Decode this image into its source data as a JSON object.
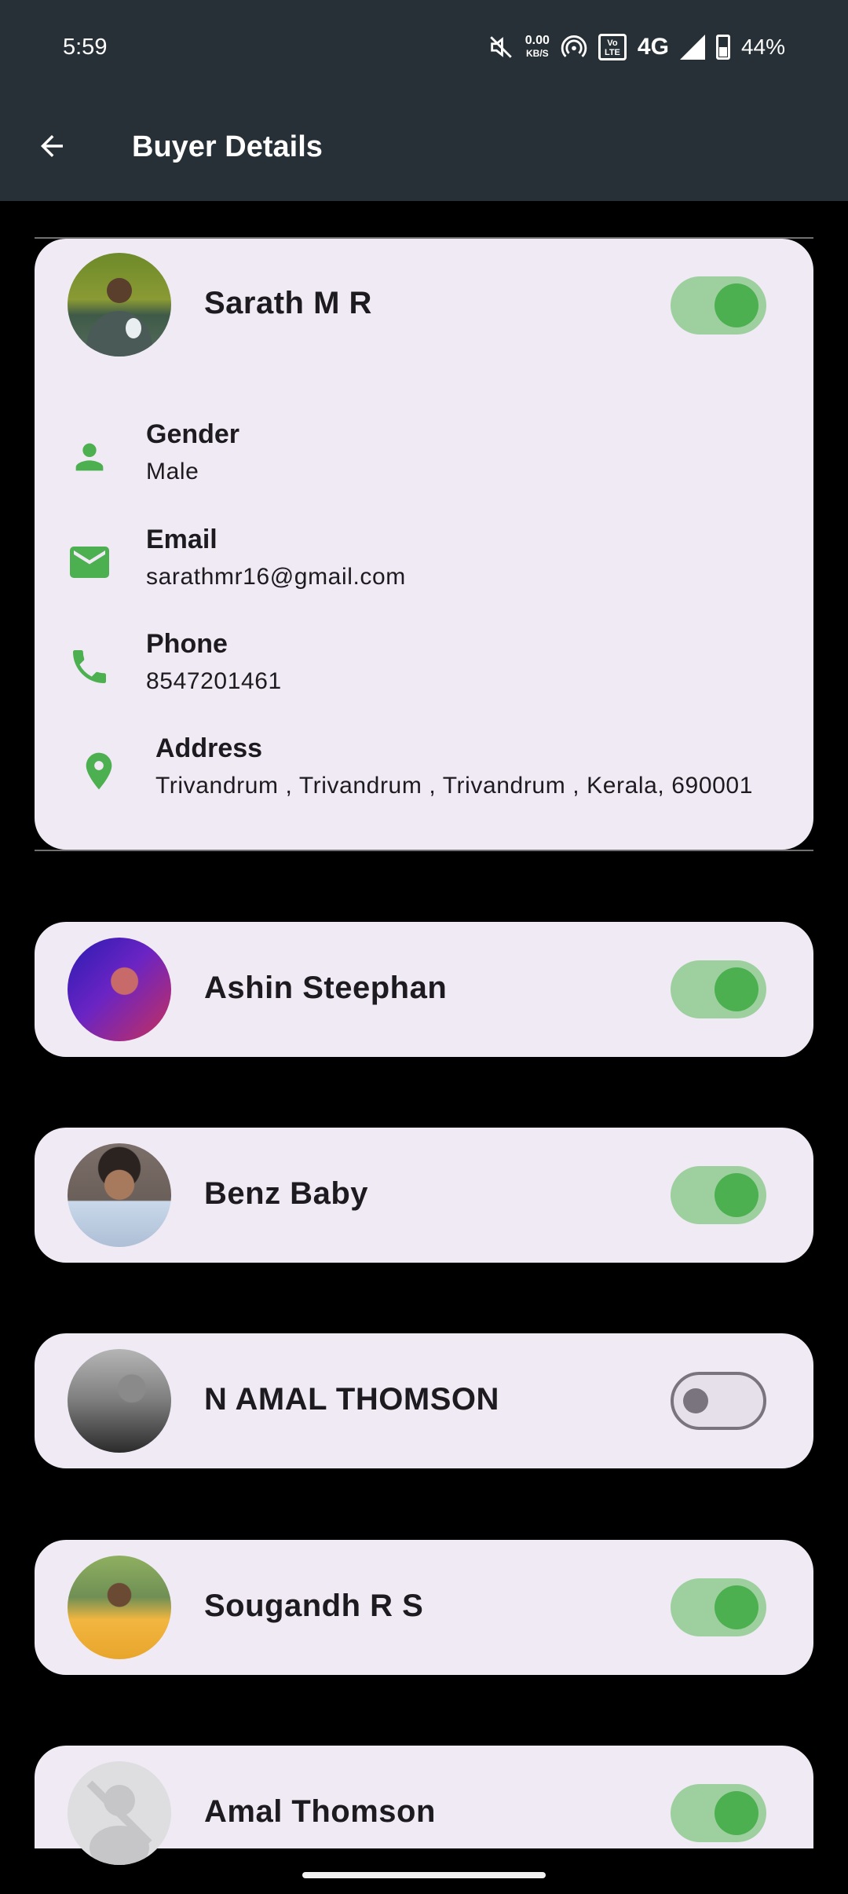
{
  "status_bar": {
    "time": "5:59",
    "speed_value": "0.00",
    "speed_unit": "KB/S",
    "volte_top": "Vo",
    "volte_bottom": "LTE",
    "network": "4G",
    "battery": "44%"
  },
  "app_bar": {
    "title": "Buyer Details",
    "back_icon": "arrow-back-icon"
  },
  "expanded_buyer": {
    "name": "Sarath M R",
    "enabled": true,
    "details": [
      {
        "label": "Gender",
        "value": "Male",
        "icon": "person-icon"
      },
      {
        "label": "Email",
        "value": "sarathmr16@gmail.com",
        "icon": "mail-icon"
      },
      {
        "label": "Phone",
        "value": "8547201461",
        "icon": "phone-icon"
      },
      {
        "label": "Address",
        "value": "Trivandrum , Trivandrum , Trivandrum , Kerala, 690001",
        "icon": "location-pin-icon"
      }
    ]
  },
  "buyers": [
    {
      "name": "Ashin Steephan",
      "enabled": true
    },
    {
      "name": "Benz Baby",
      "enabled": true
    },
    {
      "name": "N AMAL THOMSON",
      "enabled": false
    },
    {
      "name": "Sougandh R S",
      "enabled": true
    },
    {
      "name": "Amal Thomson",
      "enabled": true
    }
  ],
  "colors": {
    "app_bar": "#263036",
    "card": "#f0eaf4",
    "accent_green": "#4caf50",
    "toggle_track_on": "#9ed09f",
    "background": "#000000"
  }
}
